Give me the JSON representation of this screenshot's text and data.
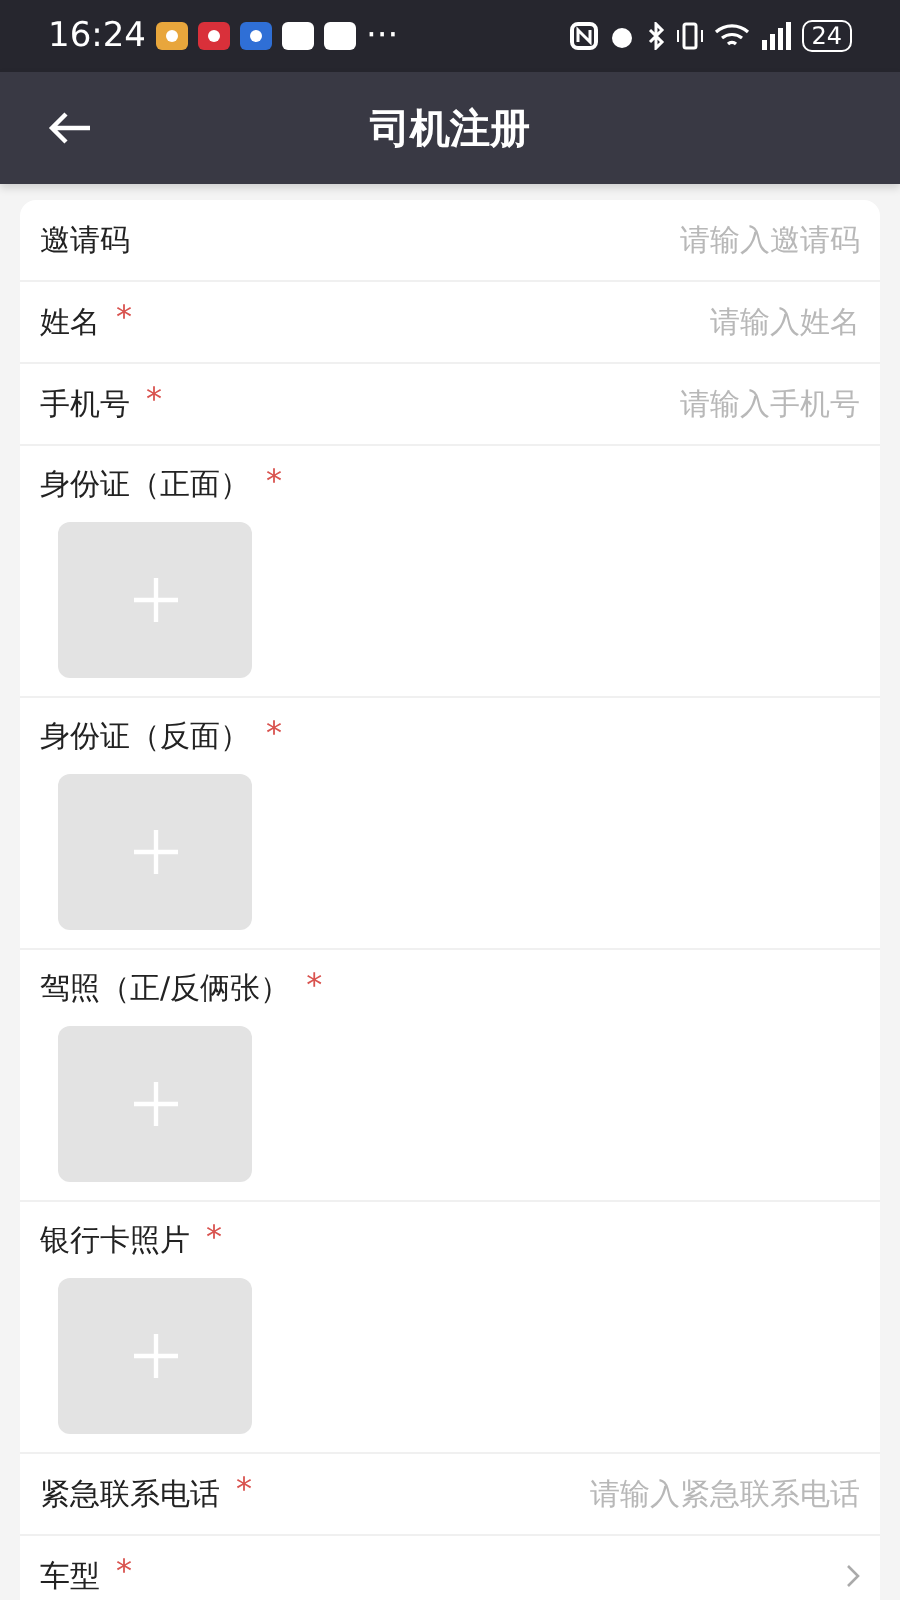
{
  "status_bar": {
    "time": "16:24",
    "more": "···",
    "battery": "24"
  },
  "header": {
    "title": "司机注册"
  },
  "fields": [
    {
      "kind": "text",
      "label": "邀请码",
      "placeholder": "请输入邀请码"
    },
    {
      "kind": "text",
      "label": "姓名",
      "required_mark": "*",
      "placeholder": "请输入姓名"
    },
    {
      "kind": "text",
      "label": "手机号",
      "required_mark": "*",
      "placeholder": "请输入手机号"
    },
    {
      "kind": "upload",
      "label": "身份证（正面）",
      "required_mark": "*"
    },
    {
      "kind": "upload",
      "label": "身份证（反面）",
      "required_mark": "*"
    },
    {
      "kind": "upload",
      "label": "驾照（正/反俩张）",
      "required_mark": "*"
    },
    {
      "kind": "upload",
      "label": "银行卡照片",
      "required_mark": "*"
    },
    {
      "kind": "text",
      "label": "紧急联系电话",
      "required_mark": "*",
      "placeholder": "请输入紧急联系电话"
    },
    {
      "kind": "select",
      "label": "车型",
      "required_mark": "*"
    }
  ]
}
